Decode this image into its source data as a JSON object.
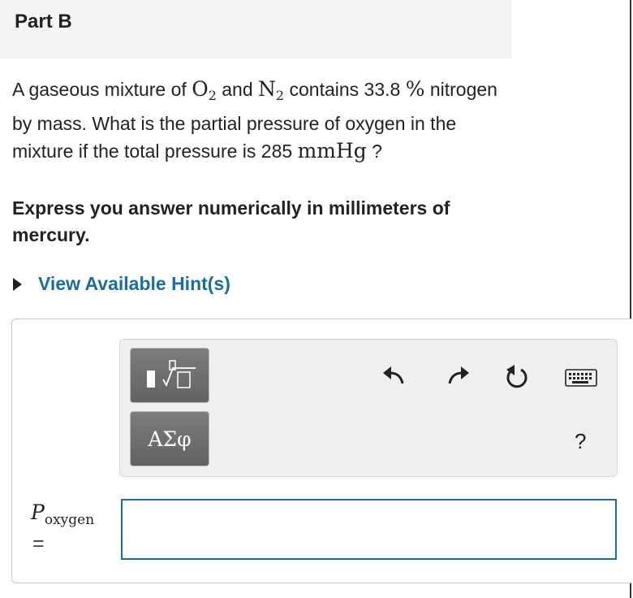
{
  "header": {
    "title": "Part B"
  },
  "question": {
    "p1": "A gaseous mixture of ",
    "o2_base": "O",
    "o2_sub": "2",
    "p2": " and ",
    "n2_base": "N",
    "n2_sub": "2",
    "p3": " contains 33.8 ",
    "percent": "%",
    "p4": " nitrogen by mass. What is the partial pressure of oxygen in the mixture if the total pressure is 285 ",
    "unit": "mmHg",
    "p5": " ?"
  },
  "instruction": "Express you answer numerically in millimeters of mercury.",
  "hint": {
    "label": "View Available Hint(s)"
  },
  "toolbar": {
    "greek_label": "ΑΣφ",
    "help_label": "?",
    "icons": [
      "templates-icon",
      "undo-icon",
      "redo-icon",
      "reset-icon",
      "keyboard-icon"
    ]
  },
  "answer": {
    "var_base": "P",
    "var_sub": "oxygen",
    "equals": "=",
    "value": ""
  },
  "colors": {
    "link": "#1a6e9e",
    "input_border": "#1a6e9e",
    "header_bg": "#f4f4f4"
  }
}
